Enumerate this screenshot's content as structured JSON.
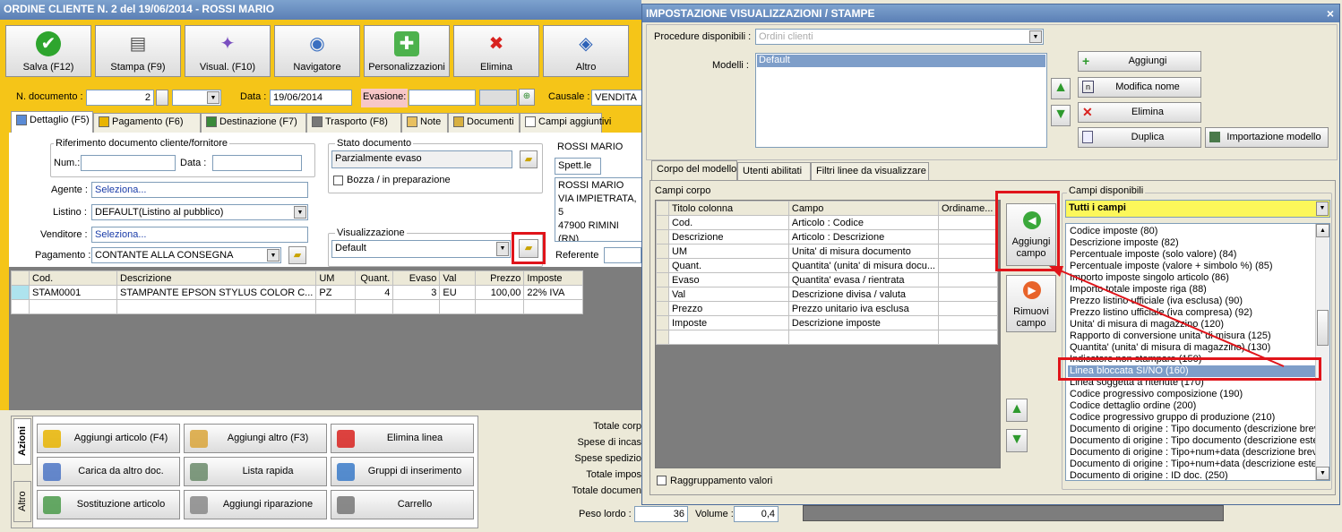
{
  "main": {
    "title": "ORDINE CLIENTE N. 2 del 19/06/2014 - ROSSI MARIO",
    "toolbar": [
      {
        "label": "Salva (F12)",
        "icon": "check-icon"
      },
      {
        "label": "Stampa (F9)",
        "icon": "printer-icon"
      },
      {
        "label": "Visual. (F10)",
        "icon": "magic-wand-icon"
      },
      {
        "label": "Navigatore",
        "icon": "compass-icon"
      },
      {
        "label": "Personalizzazioni",
        "icon": "puzzle-icon"
      },
      {
        "label": "Elimina",
        "icon": "red-x-icon"
      },
      {
        "label": "Altro",
        "icon": "book-search-icon"
      }
    ],
    "header": {
      "ndoc_label": "N. documento :",
      "ndoc_value": "2",
      "data_label": "Data :",
      "data_value": "19/06/2014",
      "evasione_label": "Evasione:",
      "causale_label": "Causale :",
      "causale_value": "VENDITA"
    },
    "tabs": [
      "Dettaglio (F5)",
      "Pagamento (F6)",
      "Destinazione (F7)",
      "Trasporto (F8)",
      "Note",
      "Documenti",
      "Campi aggiuntivi"
    ],
    "rif": {
      "title": "Riferimento documento cliente/fornitore",
      "num_label": "Num.:",
      "data_label": "Data :"
    },
    "agente_label": "Agente :",
    "agente_value": "Seleziona...",
    "listino_label": "Listino :",
    "listino_value": "DEFAULT(Listino al pubblico)",
    "venditore_label": "Venditore :",
    "venditore_value": "Seleziona...",
    "pagamento_label": "Pagamento :",
    "pagamento_value": "CONTANTE ALLA CONSEGNA",
    "stato": {
      "title": "Stato documento",
      "value": "Parzialmente evaso",
      "bozza": "Bozza / in preparazione"
    },
    "visual": {
      "title": "Visualizzazione",
      "value": "Default"
    },
    "cliente": {
      "name": "ROSSI MARIO",
      "spett": "Spett.le",
      "addr1": "ROSSI MARIO",
      "addr2": "VIA IMPIETRATA, 5",
      "addr3": "47900 RIMINI (RN)"
    },
    "referente_label": "Referente",
    "grid": {
      "columns": [
        "Cod.",
        "Descrizione",
        "UM",
        "Quant.",
        "Evaso",
        "Val",
        "Prezzo",
        "Imposte"
      ],
      "rows": [
        [
          "STAM0001",
          "STAMPANTE EPSON STYLUS COLOR C...",
          "PZ",
          "4",
          "3",
          "EU",
          "100,00",
          "22% IVA"
        ]
      ]
    },
    "actions": {
      "side_tabs": [
        "Azioni",
        "Altro"
      ],
      "buttons": [
        {
          "label": "Aggiungi articolo (F4)",
          "icon": "add-box-icon"
        },
        {
          "label": "Aggiungi altro (F3)",
          "icon": "add-grid-icon"
        },
        {
          "label": "Elimina linea",
          "icon": "red-x-icon"
        },
        {
          "label": "Carica da altro doc.",
          "icon": "checklist-icon"
        },
        {
          "label": "Lista rapida",
          "icon": "quick-list-icon"
        },
        {
          "label": "Gruppi di inserimento",
          "icon": "group-add-icon"
        },
        {
          "label": "Sostituzione articolo",
          "icon": "swap-icon"
        },
        {
          "label": "Aggiungi riparazione",
          "icon": "wrench-icon"
        },
        {
          "label": "Carrello",
          "icon": "cart-icon"
        }
      ]
    },
    "totals": {
      "labels": [
        "Totale corp",
        "Spese di incas",
        "Spese spedizio",
        "Totale impos",
        "Totale documen"
      ],
      "peso_label": "Peso lordo :",
      "peso_value": "36",
      "volume_label": "Volume :",
      "volume_value": "0,4"
    }
  },
  "dialog": {
    "title": "IMPOSTAZIONE VISUALIZZAZIONI / STAMPE",
    "close": "×",
    "procedure_label": "Procedure disponibili :",
    "procedure_value": "Ordini clienti",
    "modelli_label": "Modelli :",
    "modelli_items": [
      "Default"
    ],
    "buttons": {
      "aggiungi": "Aggiungi",
      "modifica": "Modifica nome",
      "elimina": "Elimina",
      "duplica": "Duplica",
      "importazione": "Importazione modello"
    },
    "tabs": [
      "Corpo del modello",
      "Utenti abilitati",
      "Filtri linee da visualizzare"
    ],
    "campi_corpo_label": "Campi corpo",
    "corpo_grid": {
      "columns": [
        "Titolo colonna",
        "Campo",
        "Ordiname..."
      ],
      "rows": [
        [
          "Cod.",
          "Articolo : Codice",
          ""
        ],
        [
          "Descrizione",
          "Articolo : Descrizione",
          ""
        ],
        [
          "UM",
          "Unita' di misura documento",
          ""
        ],
        [
          "Quant.",
          "Quantita' (unita' di misura docu...",
          ""
        ],
        [
          "Evaso",
          "Quantita' evasa / rientrata",
          ""
        ],
        [
          "Val",
          "Descrizione divisa / valuta",
          ""
        ],
        [
          "Prezzo",
          "Prezzo unitario iva esclusa",
          ""
        ],
        [
          "Imposte",
          "Descrizione imposte",
          ""
        ]
      ]
    },
    "aggiungi_campo": "Aggiungi campo",
    "rimuovi_campo": "Rimuovi campo",
    "raggruppamento": "Raggruppamento valori",
    "campi_disponibili_label": "Campi disponibili",
    "filter_value": "Tutti i campi",
    "campi_list": [
      "Codice imposte (80)",
      "Descrizione imposte (82)",
      "Percentuale imposte (solo valore) (84)",
      "Percentuale imposte (valore + simbolo %) (85)",
      "Importo imposte singolo articolo (86)",
      "Importo totale imposte riga (88)",
      "Prezzo listino ufficiale (iva esclusa) (90)",
      "Prezzo listino ufficiale (iva compresa) (92)",
      "Unita' di misura di magazzino (120)",
      "Rapporto di conversione unita' di misura (125)",
      "Quantita' (unita' di misura di magazzino) (130)",
      "Indicatore non stampare (150)",
      "Linea bloccata SI/NO (160)",
      "Linea soggetta a ritenute (170)",
      "Codice progressivo composizione (190)",
      "Codice dettaglio ordine (200)",
      "Codice progressivo gruppo di produzione (210)",
      "Documento di origine : Tipo documento (descrizione breve)",
      "Documento di origine : Tipo documento (descrizione estesa)",
      "Documento di origine : Tipo+num+data (descrizione breve)",
      "Documento di origine : Tipo+num+data (descrizione estesa)",
      "Documento di origine : ID doc. (250)"
    ],
    "selected_index": 12
  }
}
